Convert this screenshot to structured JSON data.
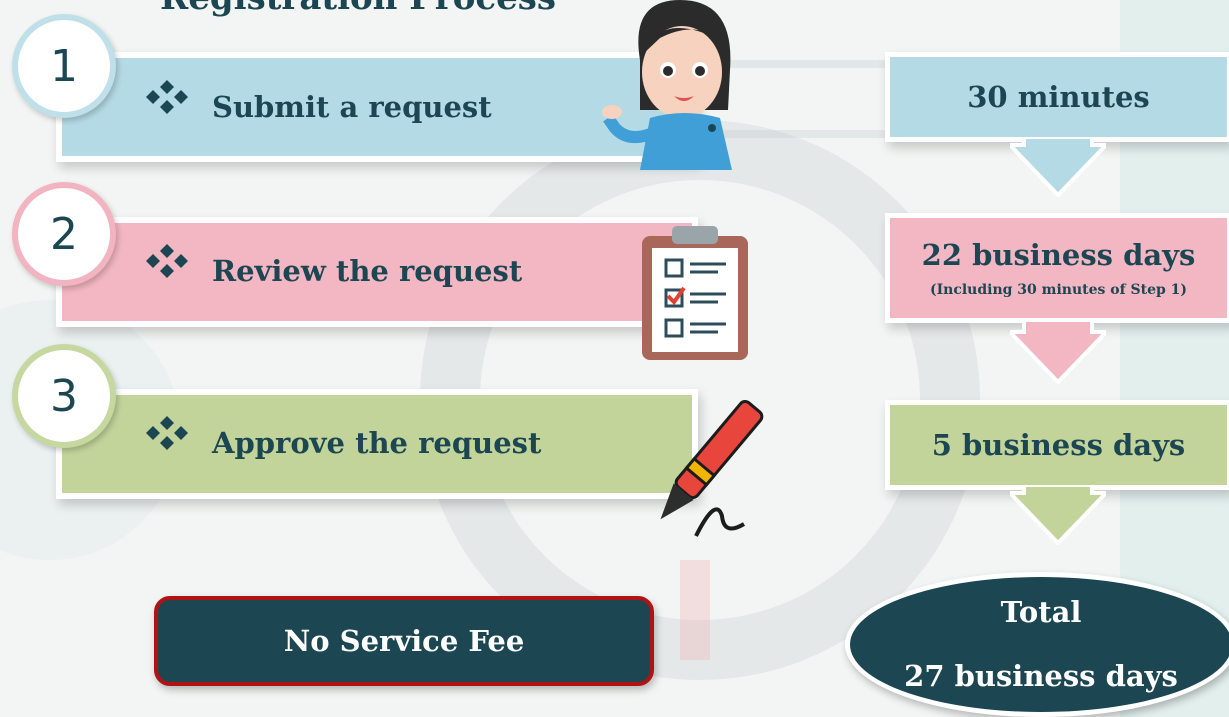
{
  "title": "Registration Process",
  "steps": [
    {
      "number": "1",
      "label": "Submit a request",
      "color": "#b4dae6",
      "border": "#bfe0e8"
    },
    {
      "number": "2",
      "label": "Review the request",
      "color": "#f3b6c3",
      "border": "#f2b4c1"
    },
    {
      "number": "3",
      "label": "Approve the request",
      "color": "#c3d49b",
      "border": "#c6d7a0"
    }
  ],
  "durations": [
    {
      "main": "30 minutes",
      "note": "",
      "color": "#b4dae6"
    },
    {
      "main": "22 business days",
      "note": "(Including 30 minutes of Step 1)",
      "color": "#f3b6c3"
    },
    {
      "main": "5 business days",
      "note": "",
      "color": "#c3d49b"
    }
  ],
  "fee": "No Service Fee",
  "total": {
    "label": "Total",
    "value": "27 business days"
  },
  "colors": {
    "dark": "#1c4752",
    "fee_border": "#b01313"
  }
}
